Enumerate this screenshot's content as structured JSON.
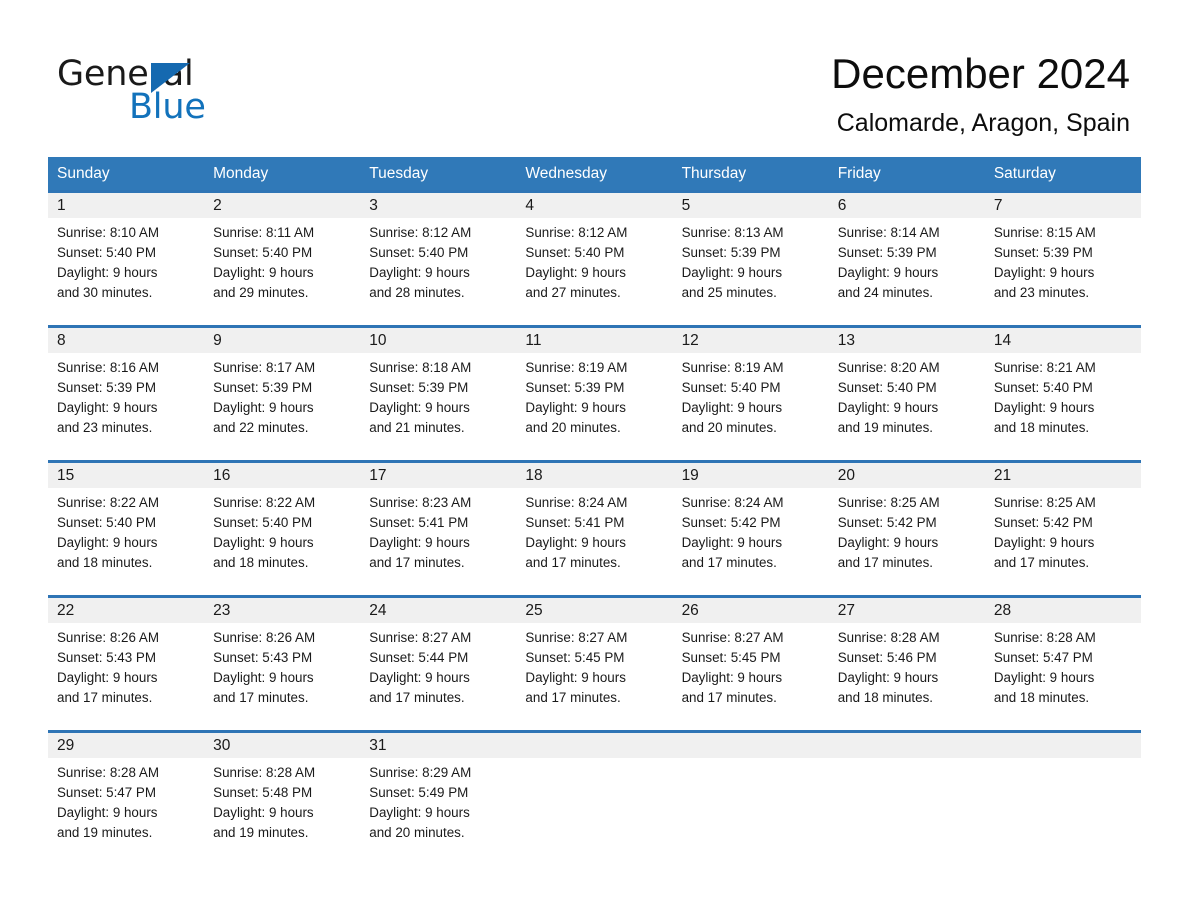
{
  "logo": {
    "word_one": "General",
    "word_two": "Blue",
    "triangle_icon": "triangle-icon",
    "accent_color": "#1272bb"
  },
  "header": {
    "title": "December 2024",
    "subtitle": "Calomarde, Aragon, Spain"
  },
  "theme": {
    "header_blue": "#3079b8",
    "row_border_blue": "#2e74b5",
    "day_band_gray": "#f0f0f0"
  },
  "calendar": {
    "weekdays": [
      "Sunday",
      "Monday",
      "Tuesday",
      "Wednesday",
      "Thursday",
      "Friday",
      "Saturday"
    ],
    "weeks": [
      [
        {
          "day": "1",
          "sunrise": "Sunrise: 8:10 AM",
          "sunset": "Sunset: 5:40 PM",
          "daylight_1": "Daylight: 9 hours",
          "daylight_2": "and 30 minutes."
        },
        {
          "day": "2",
          "sunrise": "Sunrise: 8:11 AM",
          "sunset": "Sunset: 5:40 PM",
          "daylight_1": "Daylight: 9 hours",
          "daylight_2": "and 29 minutes."
        },
        {
          "day": "3",
          "sunrise": "Sunrise: 8:12 AM",
          "sunset": "Sunset: 5:40 PM",
          "daylight_1": "Daylight: 9 hours",
          "daylight_2": "and 28 minutes."
        },
        {
          "day": "4",
          "sunrise": "Sunrise: 8:12 AM",
          "sunset": "Sunset: 5:40 PM",
          "daylight_1": "Daylight: 9 hours",
          "daylight_2": "and 27 minutes."
        },
        {
          "day": "5",
          "sunrise": "Sunrise: 8:13 AM",
          "sunset": "Sunset: 5:39 PM",
          "daylight_1": "Daylight: 9 hours",
          "daylight_2": "and 25 minutes."
        },
        {
          "day": "6",
          "sunrise": "Sunrise: 8:14 AM",
          "sunset": "Sunset: 5:39 PM",
          "daylight_1": "Daylight: 9 hours",
          "daylight_2": "and 24 minutes."
        },
        {
          "day": "7",
          "sunrise": "Sunrise: 8:15 AM",
          "sunset": "Sunset: 5:39 PM",
          "daylight_1": "Daylight: 9 hours",
          "daylight_2": "and 23 minutes."
        }
      ],
      [
        {
          "day": "8",
          "sunrise": "Sunrise: 8:16 AM",
          "sunset": "Sunset: 5:39 PM",
          "daylight_1": "Daylight: 9 hours",
          "daylight_2": "and 23 minutes."
        },
        {
          "day": "9",
          "sunrise": "Sunrise: 8:17 AM",
          "sunset": "Sunset: 5:39 PM",
          "daylight_1": "Daylight: 9 hours",
          "daylight_2": "and 22 minutes."
        },
        {
          "day": "10",
          "sunrise": "Sunrise: 8:18 AM",
          "sunset": "Sunset: 5:39 PM",
          "daylight_1": "Daylight: 9 hours",
          "daylight_2": "and 21 minutes."
        },
        {
          "day": "11",
          "sunrise": "Sunrise: 8:19 AM",
          "sunset": "Sunset: 5:39 PM",
          "daylight_1": "Daylight: 9 hours",
          "daylight_2": "and 20 minutes."
        },
        {
          "day": "12",
          "sunrise": "Sunrise: 8:19 AM",
          "sunset": "Sunset: 5:40 PM",
          "daylight_1": "Daylight: 9 hours",
          "daylight_2": "and 20 minutes."
        },
        {
          "day": "13",
          "sunrise": "Sunrise: 8:20 AM",
          "sunset": "Sunset: 5:40 PM",
          "daylight_1": "Daylight: 9 hours",
          "daylight_2": "and 19 minutes."
        },
        {
          "day": "14",
          "sunrise": "Sunrise: 8:21 AM",
          "sunset": "Sunset: 5:40 PM",
          "daylight_1": "Daylight: 9 hours",
          "daylight_2": "and 18 minutes."
        }
      ],
      [
        {
          "day": "15",
          "sunrise": "Sunrise: 8:22 AM",
          "sunset": "Sunset: 5:40 PM",
          "daylight_1": "Daylight: 9 hours",
          "daylight_2": "and 18 minutes."
        },
        {
          "day": "16",
          "sunrise": "Sunrise: 8:22 AM",
          "sunset": "Sunset: 5:40 PM",
          "daylight_1": "Daylight: 9 hours",
          "daylight_2": "and 18 minutes."
        },
        {
          "day": "17",
          "sunrise": "Sunrise: 8:23 AM",
          "sunset": "Sunset: 5:41 PM",
          "daylight_1": "Daylight: 9 hours",
          "daylight_2": "and 17 minutes."
        },
        {
          "day": "18",
          "sunrise": "Sunrise: 8:24 AM",
          "sunset": "Sunset: 5:41 PM",
          "daylight_1": "Daylight: 9 hours",
          "daylight_2": "and 17 minutes."
        },
        {
          "day": "19",
          "sunrise": "Sunrise: 8:24 AM",
          "sunset": "Sunset: 5:42 PM",
          "daylight_1": "Daylight: 9 hours",
          "daylight_2": "and 17 minutes."
        },
        {
          "day": "20",
          "sunrise": "Sunrise: 8:25 AM",
          "sunset": "Sunset: 5:42 PM",
          "daylight_1": "Daylight: 9 hours",
          "daylight_2": "and 17 minutes."
        },
        {
          "day": "21",
          "sunrise": "Sunrise: 8:25 AM",
          "sunset": "Sunset: 5:42 PM",
          "daylight_1": "Daylight: 9 hours",
          "daylight_2": "and 17 minutes."
        }
      ],
      [
        {
          "day": "22",
          "sunrise": "Sunrise: 8:26 AM",
          "sunset": "Sunset: 5:43 PM",
          "daylight_1": "Daylight: 9 hours",
          "daylight_2": "and 17 minutes."
        },
        {
          "day": "23",
          "sunrise": "Sunrise: 8:26 AM",
          "sunset": "Sunset: 5:43 PM",
          "daylight_1": "Daylight: 9 hours",
          "daylight_2": "and 17 minutes."
        },
        {
          "day": "24",
          "sunrise": "Sunrise: 8:27 AM",
          "sunset": "Sunset: 5:44 PM",
          "daylight_1": "Daylight: 9 hours",
          "daylight_2": "and 17 minutes."
        },
        {
          "day": "25",
          "sunrise": "Sunrise: 8:27 AM",
          "sunset": "Sunset: 5:45 PM",
          "daylight_1": "Daylight: 9 hours",
          "daylight_2": "and 17 minutes."
        },
        {
          "day": "26",
          "sunrise": "Sunrise: 8:27 AM",
          "sunset": "Sunset: 5:45 PM",
          "daylight_1": "Daylight: 9 hours",
          "daylight_2": "and 17 minutes."
        },
        {
          "day": "27",
          "sunrise": "Sunrise: 8:28 AM",
          "sunset": "Sunset: 5:46 PM",
          "daylight_1": "Daylight: 9 hours",
          "daylight_2": "and 18 minutes."
        },
        {
          "day": "28",
          "sunrise": "Sunrise: 8:28 AM",
          "sunset": "Sunset: 5:47 PM",
          "daylight_1": "Daylight: 9 hours",
          "daylight_2": "and 18 minutes."
        }
      ],
      [
        {
          "day": "29",
          "sunrise": "Sunrise: 8:28 AM",
          "sunset": "Sunset: 5:47 PM",
          "daylight_1": "Daylight: 9 hours",
          "daylight_2": "and 19 minutes."
        },
        {
          "day": "30",
          "sunrise": "Sunrise: 8:28 AM",
          "sunset": "Sunset: 5:48 PM",
          "daylight_1": "Daylight: 9 hours",
          "daylight_2": "and 19 minutes."
        },
        {
          "day": "31",
          "sunrise": "Sunrise: 8:29 AM",
          "sunset": "Sunset: 5:49 PM",
          "daylight_1": "Daylight: 9 hours",
          "daylight_2": "and 20 minutes."
        },
        {
          "day": "",
          "sunrise": "",
          "sunset": "",
          "daylight_1": "",
          "daylight_2": ""
        },
        {
          "day": "",
          "sunrise": "",
          "sunset": "",
          "daylight_1": "",
          "daylight_2": ""
        },
        {
          "day": "",
          "sunrise": "",
          "sunset": "",
          "daylight_1": "",
          "daylight_2": ""
        },
        {
          "day": "",
          "sunrise": "",
          "sunset": "",
          "daylight_1": "",
          "daylight_2": ""
        }
      ]
    ]
  }
}
